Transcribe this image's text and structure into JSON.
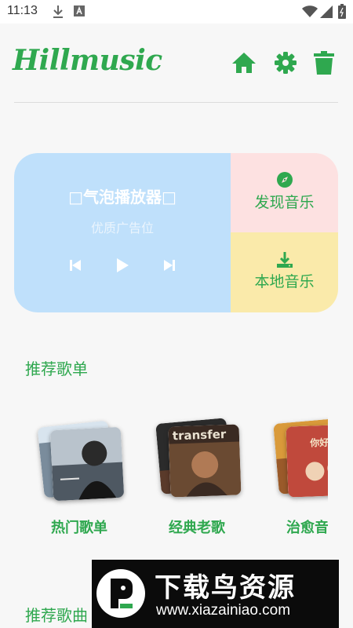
{
  "status_bar": {
    "time": "11:13"
  },
  "header": {
    "logo_text": "Hillmusic"
  },
  "player": {
    "title": "□气泡播放器□",
    "subtitle": "优质广告位"
  },
  "tiles": {
    "discover_label": "发现音乐",
    "local_label": "本地音乐"
  },
  "sections": {
    "recommended_playlists": "推荐歌单",
    "recommended_songs": "推荐歌曲"
  },
  "playlists": [
    {
      "name": "热门歌单"
    },
    {
      "name": "经典老歌"
    },
    {
      "name": "治愈音"
    }
  ],
  "album_text": {
    "cover2": "transfer",
    "cover3": "你好李"
  },
  "watermark": {
    "title": "下载鸟资源",
    "url": "www.xiazainiao.com"
  },
  "colors": {
    "accent": "#2fa84f",
    "player_bg": "#bfe0fb",
    "discover_bg": "#fde1e1",
    "local_bg": "#faeaaa"
  }
}
